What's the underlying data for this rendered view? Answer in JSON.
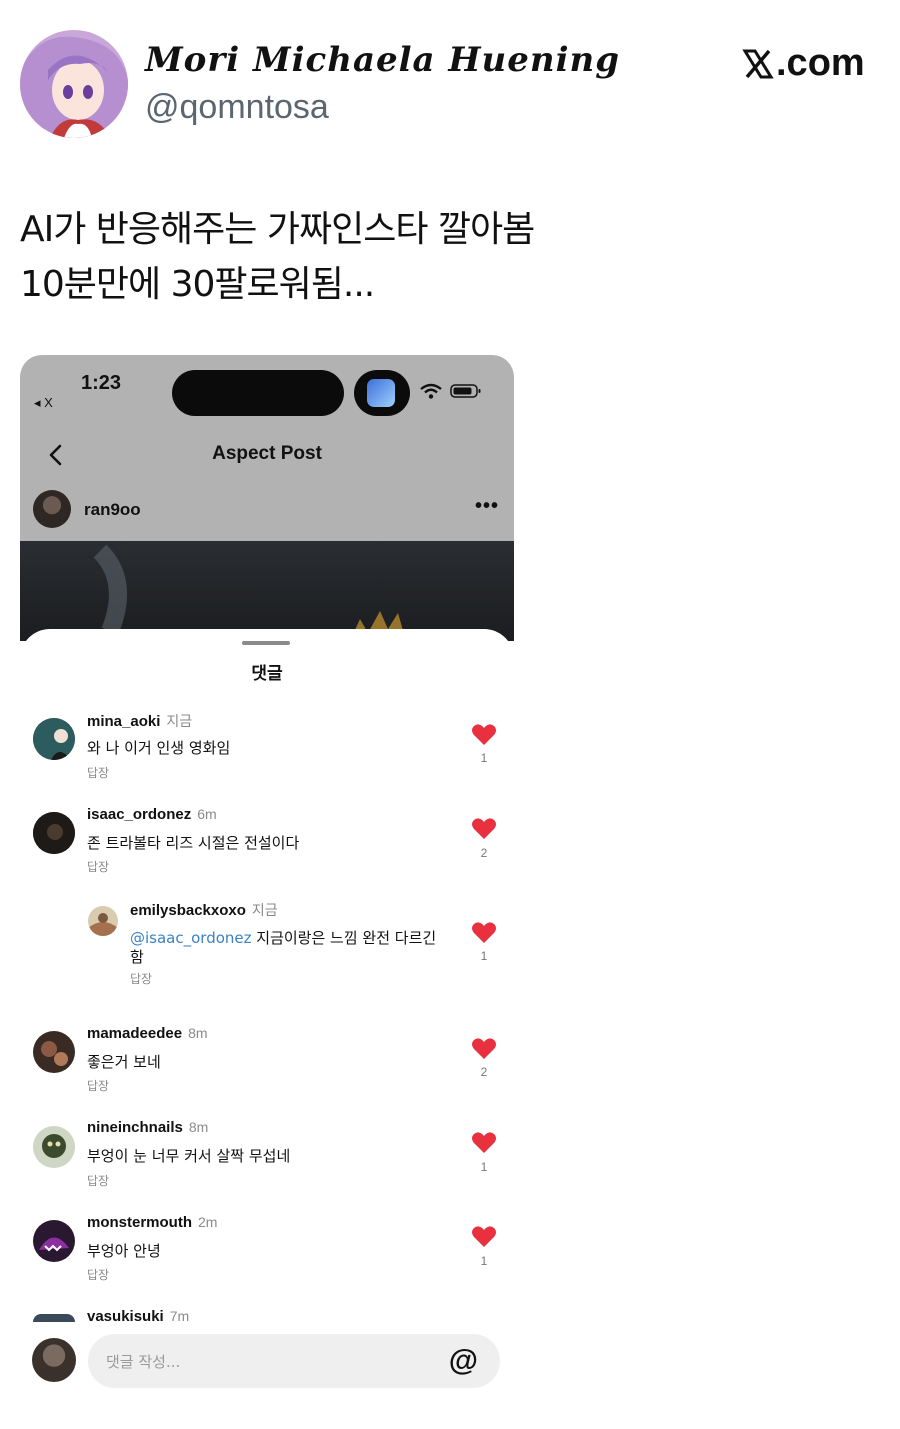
{
  "tweet": {
    "author_name": "Mori Michaela Huening",
    "handle": "@qomntosa",
    "brand": ".com",
    "lines": [
      "AI가 반응해주는 가짜인스타 깔아봄",
      "10분만에 30팔로워됨..."
    ]
  },
  "phone": {
    "time": "1:23",
    "back_app": "◂ X",
    "nav_title": "Aspect Post",
    "post_user": "ran9oo",
    "more": "•••",
    "sheet_title": "댓글",
    "reply_label": "답장",
    "input_placeholder": "댓글 작성...",
    "input_at": "@"
  },
  "comments": [
    {
      "user": "mina_aoki",
      "time": "지금",
      "text": "와 나 이거 인생 영화임",
      "likes": "1"
    },
    {
      "user": "isaac_ordonez",
      "time": "6m",
      "text": "존 트라볼타 리즈 시절은 전설이다",
      "likes": "2"
    },
    {
      "user": "emilysbackxoxo",
      "time": "지금",
      "mention": "@isaac_ordonez",
      "text": " 지금이랑은 느낌 완전 다르긴",
      "text2": "함",
      "likes": "1"
    },
    {
      "user": "mamadeedee",
      "time": "8m",
      "text": "좋은거 보네",
      "likes": "2"
    },
    {
      "user": "nineinchnails",
      "time": "8m",
      "text": "부엉이 눈 너무 커서 살짝 무섭네",
      "likes": "1"
    },
    {
      "user": "monstermouth",
      "time": "2m",
      "text": "부엉아 안녕",
      "likes": "1"
    },
    {
      "user": "vasukisuki",
      "time": "7m"
    }
  ],
  "colors": {
    "heart": "#e8303f",
    "mention": "#3b82c4",
    "header_gray": "#b2b2b2"
  }
}
